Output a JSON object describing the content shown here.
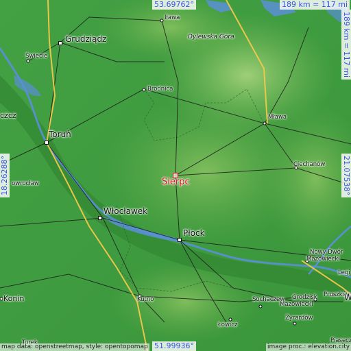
{
  "map": {
    "highlight_city": "Sierpc",
    "colors": {
      "lowland": "#3d9a3d",
      "upland": "#8dc468",
      "water": "#5a8fd6",
      "roads": "#222222",
      "motorway": "#f2c84a",
      "highlight": "#d8141a",
      "coord_text": "#3a52e0"
    },
    "coordinates": {
      "top_lat": "53.69762°",
      "bottom_lat": "51.99936°",
      "left_lon": "18.26288°",
      "right_lon": "21.07538°"
    },
    "scale": {
      "horizontal": "189 km = 117 mi",
      "vertical": "189 km = 117 mi"
    },
    "places": [
      {
        "name": "Iława",
        "icon": "city-dot-icon"
      },
      {
        "name": "Grudziądz",
        "icon": "city-square-icon"
      },
      {
        "name": "Dylewska Góra",
        "icon": "mountain-peak-icon"
      },
      {
        "name": "Świecie",
        "icon": "city-dot-icon"
      },
      {
        "name": "Brodnica",
        "icon": "city-dot-icon"
      },
      {
        "name": "Mława",
        "icon": "city-dot-icon"
      },
      {
        "name": "Toruń",
        "icon": "city-square-icon"
      },
      {
        "name": "Ciechanów",
        "icon": "city-dot-icon"
      },
      {
        "name": "Sierpc",
        "icon": "highlight-marker-icon"
      },
      {
        "name": "owrocław",
        "icon": "city-dot-icon"
      },
      {
        "name": "Włocławek",
        "icon": "city-square-icon"
      },
      {
        "name": "Płock",
        "icon": "city-square-icon"
      },
      {
        "name": "Nowy Dwór",
        "icon": "city-dot-icon"
      },
      {
        "name": "Mazowiecki",
        "icon": "none"
      },
      {
        "name": "Konin",
        "icon": "city-dot-icon"
      },
      {
        "name": "Kutno",
        "icon": "city-dot-icon"
      },
      {
        "name": "Sochaczew",
        "icon": "city-dot-icon"
      },
      {
        "name": "Grodzisk",
        "icon": "city-dot-icon"
      },
      {
        "name": "Mazowiecki",
        "icon": "none"
      },
      {
        "name": "Pruszków",
        "icon": "city-dot-icon"
      },
      {
        "name": "Łowicz",
        "icon": "city-dot-icon"
      },
      {
        "name": "Żyrardów",
        "icon": "city-dot-icon"
      },
      {
        "name": "Turek",
        "icon": "none"
      },
      {
        "name": "Piaseczno",
        "icon": "none"
      },
      {
        "name": "czcz",
        "icon": "none"
      },
      {
        "name": "W",
        "icon": "none"
      },
      {
        "name": "Legi",
        "icon": "none"
      }
    ],
    "credits": {
      "left": "map data: openstreetmap, style: opentopomap",
      "right": "image proc.: elevation.city"
    }
  }
}
